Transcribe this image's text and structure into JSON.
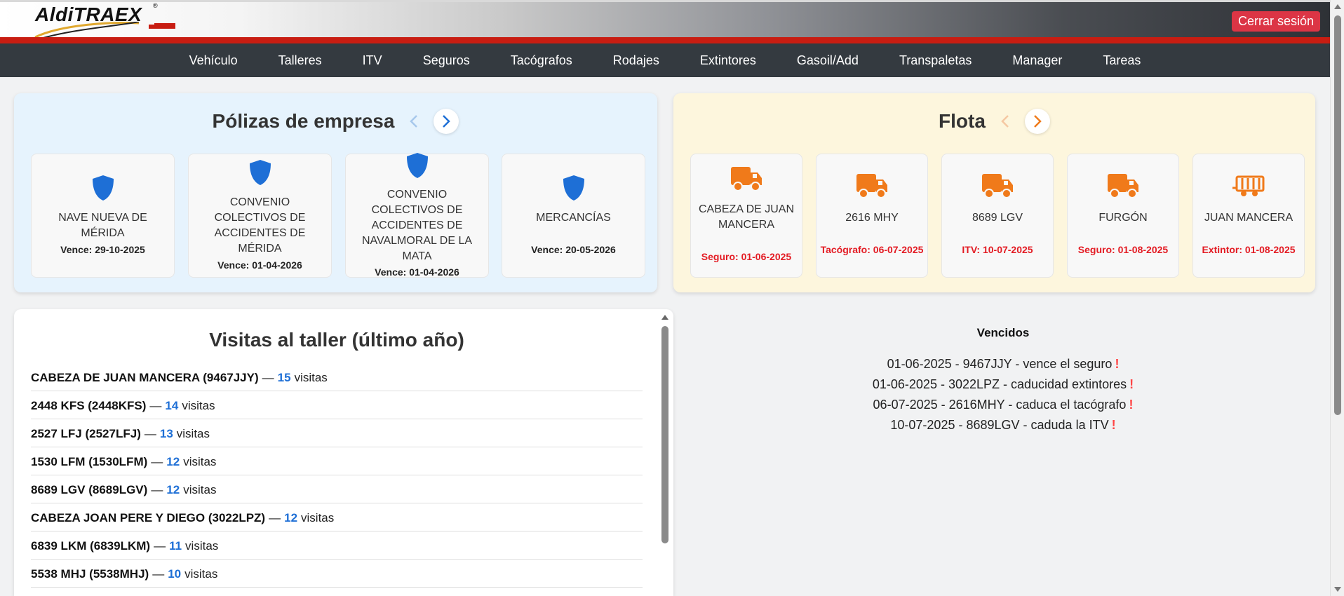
{
  "header": {
    "logo_text": "AldiTRAEX",
    "logo_mark": "®",
    "logout_label": "Cerrar sesión"
  },
  "nav": {
    "items": [
      "Vehículo",
      "Talleres",
      "ITV",
      "Seguros",
      "Tacógrafos",
      "Rodajes",
      "Extintores",
      "Gasoil/Add",
      "Transpaletas",
      "Manager",
      "Tareas"
    ]
  },
  "policies": {
    "title": "Pólizas de empresa",
    "prev_icon": "chevron-left-icon",
    "next_icon": "chevron-right-icon",
    "icon": "shield-icon",
    "icon_color": "#1e6fd6",
    "cards": [
      {
        "name": "NAVE NUEVA DE MÉRIDA",
        "date": "Vence: 29-10-2025"
      },
      {
        "name": "CONVENIO COLECTIVOS DE ACCIDENTES DE MÉRIDA",
        "date": "Vence: 01-04-2026"
      },
      {
        "name": "CONVENIO COLECTIVOS DE ACCIDENTES DE NAVALMORAL DE LA MATA",
        "date": "Vence: 01-04-2026"
      },
      {
        "name": "MERCANCÍAS",
        "date": "Vence: 20-05-2026"
      }
    ]
  },
  "fleet": {
    "title": "Flota",
    "icon_color": "#f07a1a",
    "cards": [
      {
        "name": "CABEZA DE JUAN MANCERA",
        "status": "Seguro: 01-06-2025",
        "icon": "truck-icon"
      },
      {
        "name": "2616 MHY",
        "status": "Tacógrafo: 06-07-2025",
        "icon": "truck-icon"
      },
      {
        "name": "8689 LGV",
        "status": "ITV: 10-07-2025",
        "icon": "truck-icon"
      },
      {
        "name": "FURGÓN",
        "status": "Seguro: 01-08-2025",
        "icon": "truck-icon"
      },
      {
        "name": "JUAN MANCERA",
        "status": "Extintor: 01-08-2025",
        "icon": "trailer-icon"
      }
    ]
  },
  "visits": {
    "title": "Visitas al taller (último año)",
    "separator": "—",
    "unit": "visitas",
    "rows": [
      {
        "name": "CABEZA DE JUAN MANCERA (9467JJY)",
        "count": "15"
      },
      {
        "name": "2448 KFS (2448KFS)",
        "count": "14"
      },
      {
        "name": "2527 LFJ (2527LFJ)",
        "count": "13"
      },
      {
        "name": "1530 LFM (1530LFM)",
        "count": "12"
      },
      {
        "name": "8689 LGV (8689LGV)",
        "count": "12"
      },
      {
        "name": "CABEZA JOAN PERE Y DIEGO (3022LPZ)",
        "count": "12"
      },
      {
        "name": "6839 LKM (6839LKM)",
        "count": "11"
      },
      {
        "name": "5538 MHJ (5538MHJ)",
        "count": "10"
      }
    ]
  },
  "expired": {
    "title": "Vencidos",
    "mark": "!",
    "items": [
      "01-06-2025 - 9467JJY - vence el seguro",
      "01-06-2025 - 3022LPZ - caducidad extintores",
      "06-07-2025 - 2616MHY - caduca el tacógrafo",
      "10-07-2025 - 8689LGV - caduda la ITV"
    ]
  }
}
